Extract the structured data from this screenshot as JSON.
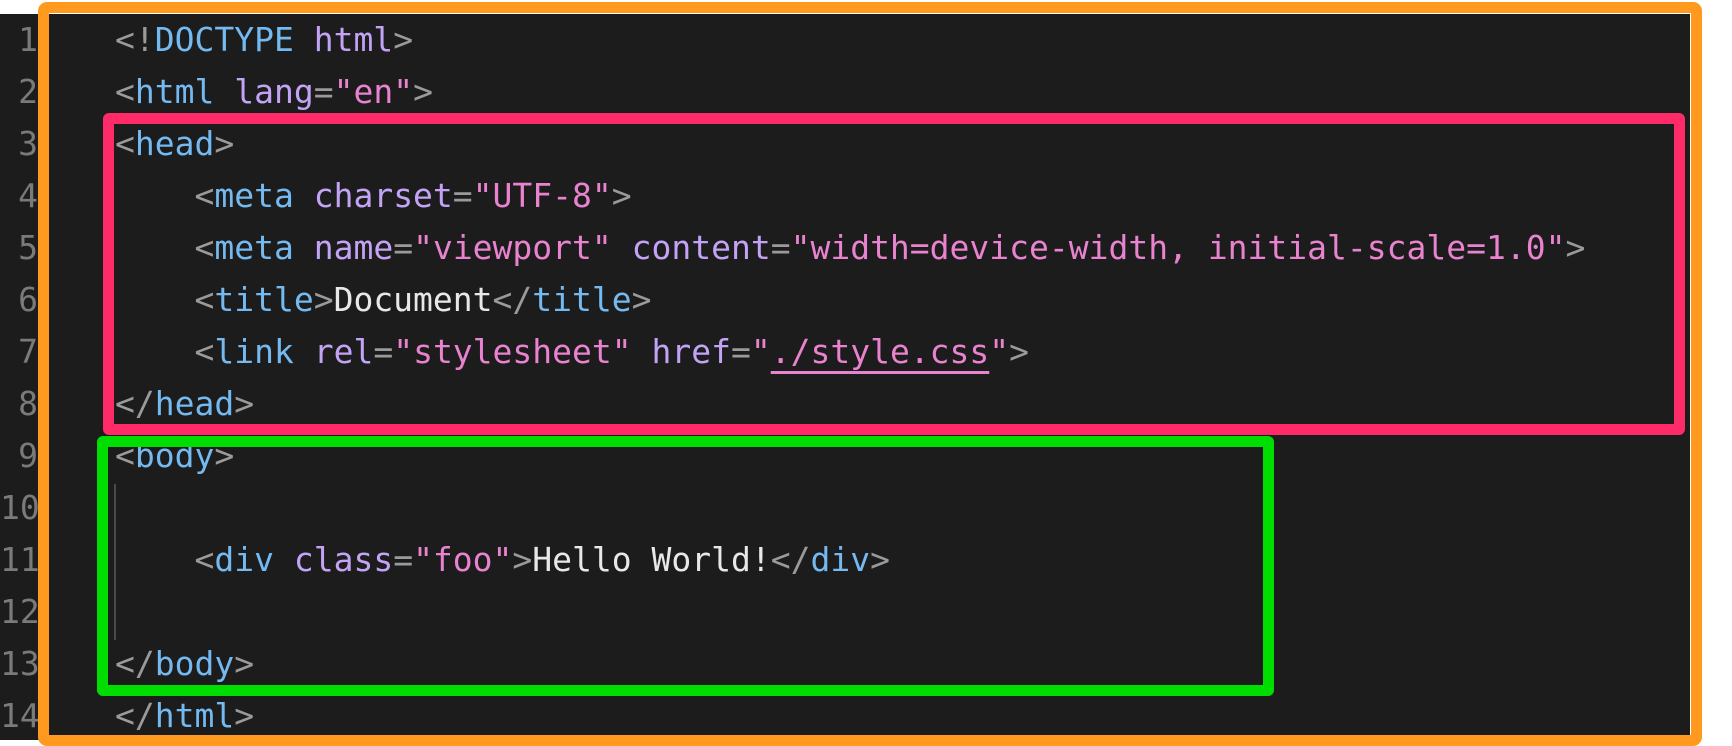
{
  "editor": {
    "lines": [
      {
        "num": "1",
        "tokens": [
          [
            "p",
            "<!"
          ],
          [
            "t",
            "DOCTYPE"
          ],
          [
            "w",
            " "
          ],
          [
            "a",
            "html"
          ],
          [
            "p",
            ">"
          ]
        ]
      },
      {
        "num": "2",
        "tokens": [
          [
            "p",
            "<"
          ],
          [
            "t",
            "html"
          ],
          [
            "w",
            " "
          ],
          [
            "a",
            "lang"
          ],
          [
            "p",
            "="
          ],
          [
            "s",
            "\"en\""
          ],
          [
            "p",
            ">"
          ]
        ]
      },
      {
        "num": "3",
        "tokens": [
          [
            "p",
            "<"
          ],
          [
            "t",
            "head"
          ],
          [
            "p",
            ">"
          ]
        ]
      },
      {
        "num": "4",
        "tokens": [
          [
            "w",
            "    "
          ],
          [
            "p",
            "<"
          ],
          [
            "t",
            "meta"
          ],
          [
            "w",
            " "
          ],
          [
            "a",
            "charset"
          ],
          [
            "p",
            "="
          ],
          [
            "s",
            "\"UTF-8\""
          ],
          [
            "p",
            ">"
          ]
        ]
      },
      {
        "num": "5",
        "tokens": [
          [
            "w",
            "    "
          ],
          [
            "p",
            "<"
          ],
          [
            "t",
            "meta"
          ],
          [
            "w",
            " "
          ],
          [
            "a",
            "name"
          ],
          [
            "p",
            "="
          ],
          [
            "s",
            "\"viewport\""
          ],
          [
            "w",
            " "
          ],
          [
            "a",
            "content"
          ],
          [
            "p",
            "="
          ],
          [
            "s",
            "\"width=device-width, initial-scale=1.0\""
          ],
          [
            "p",
            ">"
          ]
        ]
      },
      {
        "num": "6",
        "tokens": [
          [
            "w",
            "    "
          ],
          [
            "p",
            "<"
          ],
          [
            "t",
            "title"
          ],
          [
            "p",
            ">"
          ],
          [
            "w",
            "Document"
          ],
          [
            "p",
            "</"
          ],
          [
            "t",
            "title"
          ],
          [
            "p",
            ">"
          ]
        ]
      },
      {
        "num": "7",
        "tokens": [
          [
            "w",
            "    "
          ],
          [
            "p",
            "<"
          ],
          [
            "t",
            "link"
          ],
          [
            "w",
            " "
          ],
          [
            "a",
            "rel"
          ],
          [
            "p",
            "="
          ],
          [
            "s",
            "\"stylesheet\""
          ],
          [
            "w",
            " "
          ],
          [
            "a",
            "href"
          ],
          [
            "p",
            "="
          ],
          [
            "s",
            "\""
          ],
          [
            "su",
            "./style.css"
          ],
          [
            "s",
            "\""
          ],
          [
            "p",
            ">"
          ]
        ]
      },
      {
        "num": "8",
        "tokens": [
          [
            "p",
            "</"
          ],
          [
            "t",
            "head"
          ],
          [
            "p",
            ">"
          ]
        ]
      },
      {
        "num": "9",
        "tokens": [
          [
            "p",
            "<"
          ],
          [
            "t",
            "body"
          ],
          [
            "p",
            ">"
          ]
        ]
      },
      {
        "num": "10",
        "tokens": []
      },
      {
        "num": "11",
        "tokens": [
          [
            "w",
            "    "
          ],
          [
            "p",
            "<"
          ],
          [
            "t",
            "div"
          ],
          [
            "w",
            " "
          ],
          [
            "a",
            "class"
          ],
          [
            "p",
            "="
          ],
          [
            "s",
            "\"foo\""
          ],
          [
            "p",
            ">"
          ],
          [
            "w",
            "Hello World!"
          ],
          [
            "p",
            "</"
          ],
          [
            "t",
            "div"
          ],
          [
            "p",
            ">"
          ]
        ]
      },
      {
        "num": "12",
        "tokens": []
      },
      {
        "num": "13",
        "tokens": [
          [
            "p",
            "</"
          ],
          [
            "t",
            "body"
          ],
          [
            "p",
            ">"
          ]
        ]
      },
      {
        "num": "14",
        "tokens": [
          [
            "p",
            "</"
          ],
          [
            "t",
            "html"
          ],
          [
            "p",
            ">"
          ]
        ]
      }
    ]
  },
  "highlight_colors": {
    "document": "#ff9a1e",
    "head": "#ff2a68",
    "body": "#00dd00"
  }
}
